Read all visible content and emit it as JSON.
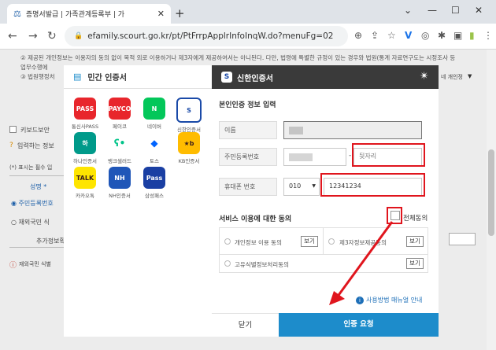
{
  "browser": {
    "tab_title": "증명서발급 | 가족관계등록부 | 가",
    "url": "efamily.scourt.go.kr/pt/PtFrrpApplrInfoInqW.do?menuFg=02"
  },
  "background": {
    "notice_line1": "② 제공된 개인정보는 이용자의 동의 없이 목적 외로 이용하거나 제3자에게 제공하여서는 아니된다. 다만, 법령에 특별한 규정이 있는 경우와 법원(통계 자료연구도는 시정조사 등",
    "notice_line2": "업무수행에",
    "notice_line3": "③ 법원행정처",
    "notice_right": "네 개인정",
    "keyboard_label": "키보드보안",
    "input_hint": "입력하는 정보",
    "required_hint": "(*) 표시는 필수 입",
    "name_label": "성명 *",
    "resident_label": "주민등록번호",
    "foreign_label": "재외국민 식",
    "additional_label": "추가정보확",
    "footer_note": "재외국민 식별"
  },
  "left_panel": {
    "title": "민간 인증서",
    "providers": [
      {
        "name": "통신사PASS",
        "icon": "pass-icon",
        "glyph": "PASS",
        "color": "#e8262c"
      },
      {
        "name": "페이코",
        "icon": "payco-icon",
        "glyph": "PAYCO",
        "color": "#e8262c"
      },
      {
        "name": "네이버",
        "icon": "naver-icon",
        "glyph": "N",
        "color": "#03c75a"
      },
      {
        "name": "신한인증서",
        "icon": "shinhan-icon",
        "glyph": "S",
        "color": "#1a4aa8"
      },
      {
        "name": "하나인증서",
        "icon": "hana-icon",
        "glyph": "하",
        "color": "#009a8a"
      },
      {
        "name": "뱅크샐러드",
        "icon": "banksalad-icon",
        "glyph": "ʕ•",
        "color": "#00c389"
      },
      {
        "name": "토스",
        "icon": "toss-icon",
        "glyph": "◆",
        "color": "#0064ff"
      },
      {
        "name": "KB인증서",
        "icon": "kb-icon",
        "glyph": "★b",
        "color": "#ffbc00"
      },
      {
        "name": "카카오톡",
        "icon": "kakao-icon",
        "glyph": "TALK",
        "color": "#fee500"
      },
      {
        "name": "NH인증서",
        "icon": "nh-icon",
        "glyph": "NH",
        "color": "#1f56b8"
      },
      {
        "name": "삼성패스",
        "icon": "samsungpass-icon",
        "glyph": "Pass",
        "color": "#1a3fa3"
      }
    ]
  },
  "right_panel": {
    "title": "신한인증서",
    "section_info": "본인인증 정보 입력",
    "name_label": "이름",
    "rrn_label": "주민등록번호",
    "rrn_back_placeholder": "뒷자리",
    "phone_label": "휴대폰 번호",
    "phone_prefix": "010",
    "phone_number": "12341234",
    "section_agree": "서비스 이용에 대한 동의",
    "agree_all_label": "전체동의",
    "agree_items": [
      {
        "label": "개인정보 이용 동의",
        "button": "보기"
      },
      {
        "label": "제3자정보제공동의",
        "button": "보기"
      },
      {
        "label": "고유식별정보처리동의",
        "button": "보기"
      }
    ],
    "manual_link": "사용방법 매뉴얼 안내",
    "close_button": "닫기",
    "auth_button": "인증 요청"
  },
  "colors": {
    "accent_blue": "#1d8ccb",
    "header_dark": "#3a3a3a",
    "highlight_red": "#e0151d"
  }
}
